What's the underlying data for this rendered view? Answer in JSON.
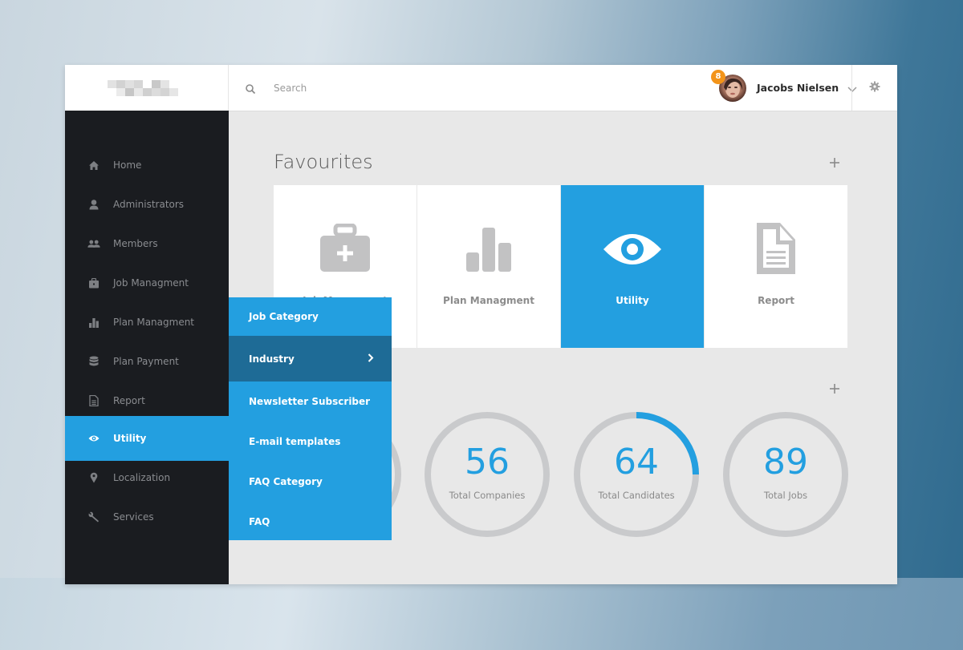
{
  "header": {
    "search_placeholder": "Search",
    "user": {
      "name": "Jacobs Nielsen",
      "notification_count": "8"
    }
  },
  "sidebar": {
    "items": [
      {
        "label": "Home",
        "icon": "home-icon"
      },
      {
        "label": "Administrators",
        "icon": "user-icon"
      },
      {
        "label": "Members",
        "icon": "users-icon"
      },
      {
        "label": "Job Managment",
        "icon": "briefcase-icon"
      },
      {
        "label": "Plan Managment",
        "icon": "bar-chart-icon"
      },
      {
        "label": "Plan Payment",
        "icon": "database-icon"
      },
      {
        "label": "Report",
        "icon": "document-icon"
      },
      {
        "label": "Utility",
        "icon": "eye-icon",
        "active": true
      },
      {
        "label": "Localization",
        "icon": "map-pin-icon"
      },
      {
        "label": "Services",
        "icon": "wrench-icon"
      }
    ]
  },
  "submenu": {
    "items": [
      {
        "label": "Job Category"
      },
      {
        "label": "Industry",
        "hovered": true,
        "has_children": true
      },
      {
        "label": "Newsletter Subscriber"
      },
      {
        "label": "E-mail templates"
      },
      {
        "label": "FAQ Category"
      },
      {
        "label": "FAQ"
      }
    ]
  },
  "favourites": {
    "title": "Favourites",
    "tiles": [
      {
        "label": "Job Managment",
        "icon": "first-aid-kit-icon"
      },
      {
        "label": "Plan Managment",
        "icon": "bar-chart-icon"
      },
      {
        "label": "Utility",
        "icon": "eye-icon",
        "selected": true
      },
      {
        "label": "Report",
        "icon": "document-icon"
      }
    ]
  },
  "stats": {
    "items": [
      {
        "value": "",
        "label": "",
        "progress": 0
      },
      {
        "value": "56",
        "label": "Total Companies",
        "progress": 0
      },
      {
        "value": "64",
        "label": "Total Candidates",
        "progress": 0.25
      },
      {
        "value": "89",
        "label": "Total Jobs",
        "progress": 0
      }
    ]
  },
  "colors": {
    "accent": "#239fe0",
    "accent_dark": "#1e6b96",
    "sidebar_bg": "#1a1c20",
    "badge": "#f39419",
    "ring_track": "#c9cacc"
  }
}
